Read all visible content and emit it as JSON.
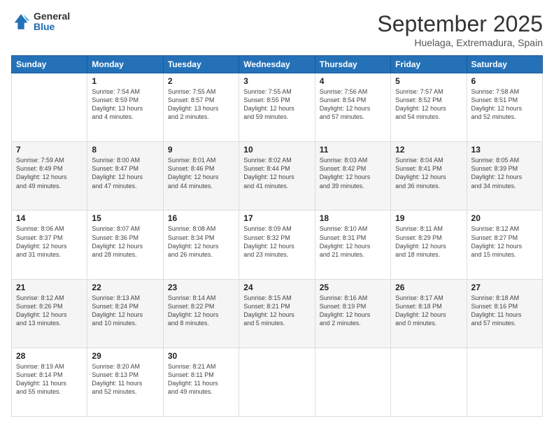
{
  "logo": {
    "general": "General",
    "blue": "Blue"
  },
  "header": {
    "month": "September 2025",
    "location": "Huelaga, Extremadura, Spain"
  },
  "weekdays": [
    "Sunday",
    "Monday",
    "Tuesday",
    "Wednesday",
    "Thursday",
    "Friday",
    "Saturday"
  ],
  "weeks": [
    [
      {
        "day": "",
        "info": ""
      },
      {
        "day": "1",
        "info": "Sunrise: 7:54 AM\nSunset: 8:59 PM\nDaylight: 13 hours\nand 4 minutes."
      },
      {
        "day": "2",
        "info": "Sunrise: 7:55 AM\nSunset: 8:57 PM\nDaylight: 13 hours\nand 2 minutes."
      },
      {
        "day": "3",
        "info": "Sunrise: 7:55 AM\nSunset: 8:55 PM\nDaylight: 12 hours\nand 59 minutes."
      },
      {
        "day": "4",
        "info": "Sunrise: 7:56 AM\nSunset: 8:54 PM\nDaylight: 12 hours\nand 57 minutes."
      },
      {
        "day": "5",
        "info": "Sunrise: 7:57 AM\nSunset: 8:52 PM\nDaylight: 12 hours\nand 54 minutes."
      },
      {
        "day": "6",
        "info": "Sunrise: 7:58 AM\nSunset: 8:51 PM\nDaylight: 12 hours\nand 52 minutes."
      }
    ],
    [
      {
        "day": "7",
        "info": "Sunrise: 7:59 AM\nSunset: 8:49 PM\nDaylight: 12 hours\nand 49 minutes."
      },
      {
        "day": "8",
        "info": "Sunrise: 8:00 AM\nSunset: 8:47 PM\nDaylight: 12 hours\nand 47 minutes."
      },
      {
        "day": "9",
        "info": "Sunrise: 8:01 AM\nSunset: 8:46 PM\nDaylight: 12 hours\nand 44 minutes."
      },
      {
        "day": "10",
        "info": "Sunrise: 8:02 AM\nSunset: 8:44 PM\nDaylight: 12 hours\nand 41 minutes."
      },
      {
        "day": "11",
        "info": "Sunrise: 8:03 AM\nSunset: 8:42 PM\nDaylight: 12 hours\nand 39 minutes."
      },
      {
        "day": "12",
        "info": "Sunrise: 8:04 AM\nSunset: 8:41 PM\nDaylight: 12 hours\nand 36 minutes."
      },
      {
        "day": "13",
        "info": "Sunrise: 8:05 AM\nSunset: 8:39 PM\nDaylight: 12 hours\nand 34 minutes."
      }
    ],
    [
      {
        "day": "14",
        "info": "Sunrise: 8:06 AM\nSunset: 8:37 PM\nDaylight: 12 hours\nand 31 minutes."
      },
      {
        "day": "15",
        "info": "Sunrise: 8:07 AM\nSunset: 8:36 PM\nDaylight: 12 hours\nand 28 minutes."
      },
      {
        "day": "16",
        "info": "Sunrise: 8:08 AM\nSunset: 8:34 PM\nDaylight: 12 hours\nand 26 minutes."
      },
      {
        "day": "17",
        "info": "Sunrise: 8:09 AM\nSunset: 8:32 PM\nDaylight: 12 hours\nand 23 minutes."
      },
      {
        "day": "18",
        "info": "Sunrise: 8:10 AM\nSunset: 8:31 PM\nDaylight: 12 hours\nand 21 minutes."
      },
      {
        "day": "19",
        "info": "Sunrise: 8:11 AM\nSunset: 8:29 PM\nDaylight: 12 hours\nand 18 minutes."
      },
      {
        "day": "20",
        "info": "Sunrise: 8:12 AM\nSunset: 8:27 PM\nDaylight: 12 hours\nand 15 minutes."
      }
    ],
    [
      {
        "day": "21",
        "info": "Sunrise: 8:12 AM\nSunset: 8:26 PM\nDaylight: 12 hours\nand 13 minutes."
      },
      {
        "day": "22",
        "info": "Sunrise: 8:13 AM\nSunset: 8:24 PM\nDaylight: 12 hours\nand 10 minutes."
      },
      {
        "day": "23",
        "info": "Sunrise: 8:14 AM\nSunset: 8:22 PM\nDaylight: 12 hours\nand 8 minutes."
      },
      {
        "day": "24",
        "info": "Sunrise: 8:15 AM\nSunset: 8:21 PM\nDaylight: 12 hours\nand 5 minutes."
      },
      {
        "day": "25",
        "info": "Sunrise: 8:16 AM\nSunset: 8:19 PM\nDaylight: 12 hours\nand 2 minutes."
      },
      {
        "day": "26",
        "info": "Sunrise: 8:17 AM\nSunset: 8:18 PM\nDaylight: 12 hours\nand 0 minutes."
      },
      {
        "day": "27",
        "info": "Sunrise: 8:18 AM\nSunset: 8:16 PM\nDaylight: 11 hours\nand 57 minutes."
      }
    ],
    [
      {
        "day": "28",
        "info": "Sunrise: 8:19 AM\nSunset: 8:14 PM\nDaylight: 11 hours\nand 55 minutes."
      },
      {
        "day": "29",
        "info": "Sunrise: 8:20 AM\nSunset: 8:13 PM\nDaylight: 11 hours\nand 52 minutes."
      },
      {
        "day": "30",
        "info": "Sunrise: 8:21 AM\nSunset: 8:11 PM\nDaylight: 11 hours\nand 49 minutes."
      },
      {
        "day": "",
        "info": ""
      },
      {
        "day": "",
        "info": ""
      },
      {
        "day": "",
        "info": ""
      },
      {
        "day": "",
        "info": ""
      }
    ]
  ]
}
